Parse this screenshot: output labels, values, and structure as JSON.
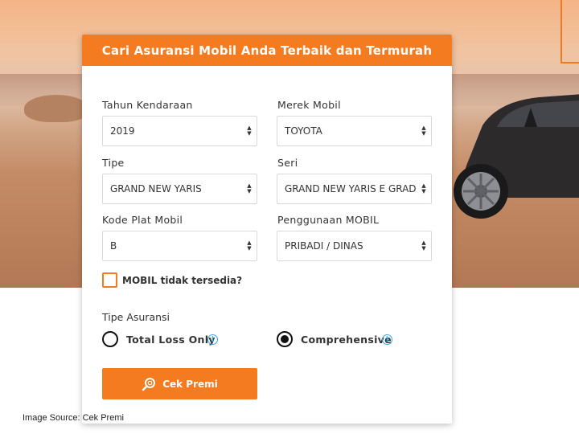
{
  "form": {
    "title": "Cari Asuransi Mobil Anda Terbaik dan Termurah",
    "fields": {
      "tahun": {
        "label": "Tahun Kendaraan",
        "value": "2019"
      },
      "merek": {
        "label": "Merek Mobil",
        "value": "TOYOTA"
      },
      "tipe": {
        "label": "Tipe",
        "value": "GRAND NEW YARIS"
      },
      "seri": {
        "label": "Seri",
        "value": "GRAND NEW YARIS E GRAD"
      },
      "plat": {
        "label": "Kode Plat Mobil",
        "value": "B"
      },
      "penggunaan": {
        "label": "Penggunaan MOBIL",
        "value": "PRIBADI / DINAS"
      }
    },
    "checkbox": {
      "label": "MOBIL tidak tersedia?",
      "checked": false
    },
    "insurance_type": {
      "label": "Tipe Asuransi",
      "options": [
        {
          "label": "Total Loss Only",
          "selected": false
        },
        {
          "label": "Comprehensive",
          "selected": true
        }
      ]
    },
    "submit_label": "Cek Premi"
  },
  "caption": "Image Source: Cek Premi",
  "colors": {
    "accent": "#f47b20",
    "info": "#3aa3e3"
  }
}
